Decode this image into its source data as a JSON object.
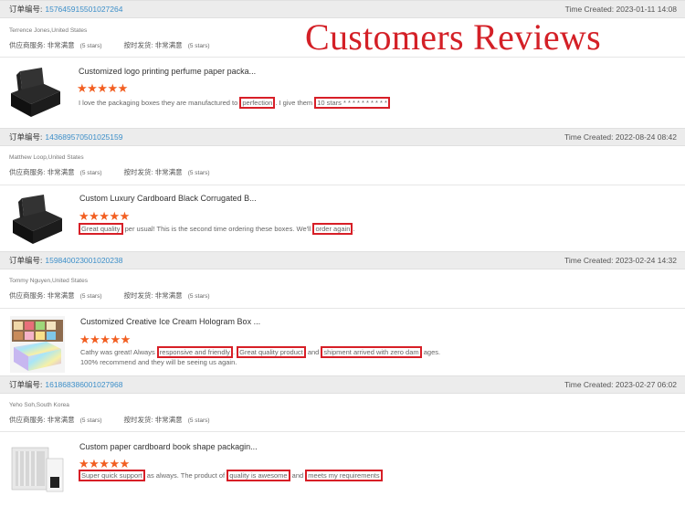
{
  "banner": "Customers Reviews",
  "labels": {
    "order_no": "订单编号:",
    "supplier_service": "供应商服务: 非常满意",
    "on_time": "按时发货: 非常满意",
    "stars_sub": "(5 stars)"
  },
  "orders": [
    {
      "order_number": "157645915501027264",
      "time_created": "Time Created: 2023-01-11 14:08",
      "buyer": "Terrence Jones,United States",
      "product": "Customized logo printing perfume paper packa...",
      "stars": "★★★★★",
      "review": [
        {
          "t": "I love the packaging boxes they are manufactured to ",
          "h": false
        },
        {
          "t": "perfection",
          "h": true
        },
        {
          "t": ". I give them ",
          "h": false
        },
        {
          "t": "10 stars * * * * * * * * * *",
          "h": true
        }
      ],
      "thumb": "black-box"
    },
    {
      "order_number": "143689570501025159",
      "time_created": "Time Created: 2022-08-24 08:42",
      "buyer": "Matthew Loop,United States",
      "product": "Custom Luxury Cardboard Black Corrugated B...",
      "stars": "★★★★★",
      "review": [
        {
          "t": "Great quality",
          "h": true
        },
        {
          "t": " per usual! This is the second time ordering these boxes. We'll ",
          "h": false
        },
        {
          "t": "order again",
          "h": true
        },
        {
          "t": ".",
          "h": false
        }
      ],
      "thumb": "black-box"
    },
    {
      "order_number": "159840023001020238",
      "time_created": "Time Created: 2023-02-24 14:32",
      "buyer": "Tommy Nguyen,United States",
      "product": "Customized Creative Ice Cream Hologram Box ...",
      "stars": "★★★★★",
      "review": [
        {
          "t": "Cathy was great! Always ",
          "h": false
        },
        {
          "t": "responsive and friendly",
          "h": true
        },
        {
          "t": ". ",
          "h": false
        },
        {
          "t": "Great quality product",
          "h": true
        },
        {
          "t": " and ",
          "h": false
        },
        {
          "t": "shipment arrived with zero dam",
          "h": true
        },
        {
          "t": " ages. 100% recommend and they will be seeing us again.",
          "h": false
        }
      ],
      "thumb": "holo-box"
    },
    {
      "order_number": "161868386001027968",
      "time_created": "Time Created: 2023-02-27 06:02",
      "buyer": "Yeho Soh,South Korea",
      "product": "Custom paper cardboard book shape packagin...",
      "stars": "★★★★★",
      "review": [
        {
          "t": "Super quick support",
          "h": true
        },
        {
          "t": " as always. The product of ",
          "h": false
        },
        {
          "t": "quality is awesome",
          "h": true
        },
        {
          "t": " and ",
          "h": false
        },
        {
          "t": "meets my requirements",
          "h": true
        }
      ],
      "thumb": "book-box"
    }
  ]
}
